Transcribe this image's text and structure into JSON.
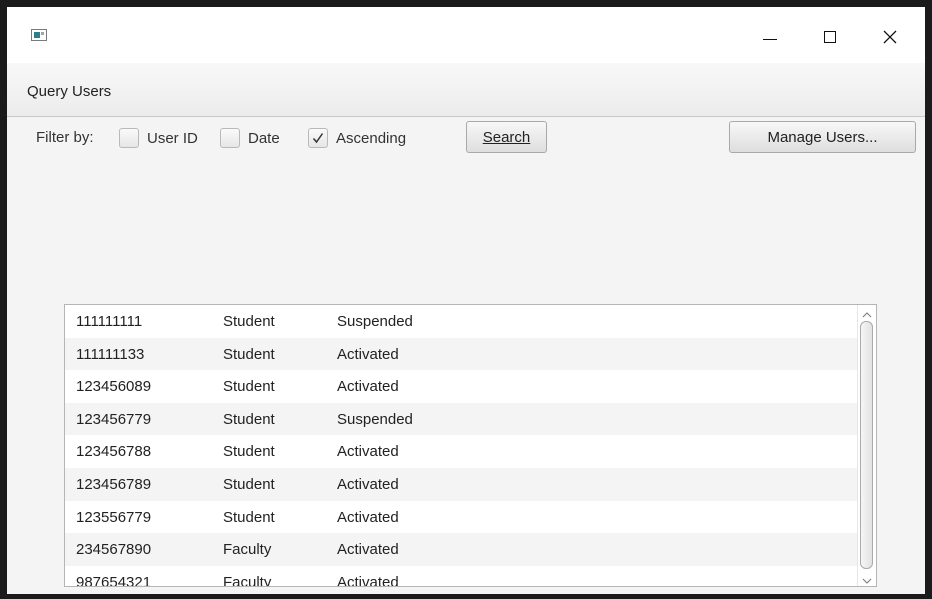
{
  "window": {
    "title": "",
    "icon": "app-window-icon",
    "controls": [
      "minimize-icon",
      "maximize-icon",
      "close-icon"
    ]
  },
  "menu": {
    "items": [
      {
        "label": "Query Users"
      }
    ]
  },
  "toolbar": {
    "filter_label": "Filter by:",
    "checkboxes": [
      {
        "label": "User ID",
        "checked": false
      },
      {
        "label": "Date",
        "checked": false
      },
      {
        "label": "Ascending",
        "checked": true
      }
    ],
    "search_label": "Search",
    "manage_label": "Manage Users..."
  },
  "users": [
    {
      "id": "111111111",
      "role": "Student",
      "status": "Suspended"
    },
    {
      "id": "111111133",
      "role": "Student",
      "status": "Activated"
    },
    {
      "id": "123456089",
      "role": "Student",
      "status": "Activated"
    },
    {
      "id": "123456779",
      "role": "Student",
      "status": "Suspended"
    },
    {
      "id": "123456788",
      "role": "Student",
      "status": "Activated"
    },
    {
      "id": "123456789",
      "role": "Student",
      "status": "Activated"
    },
    {
      "id": "123556779",
      "role": "Student",
      "status": "Activated"
    },
    {
      "id": "234567890",
      "role": "Faculty",
      "status": "Activated"
    },
    {
      "id": "987654321",
      "role": "Faculty",
      "status": "Activated"
    }
  ],
  "scrollbar": {
    "up_icon": "chevron-up-icon",
    "down_icon": "chevron-down-icon"
  }
}
